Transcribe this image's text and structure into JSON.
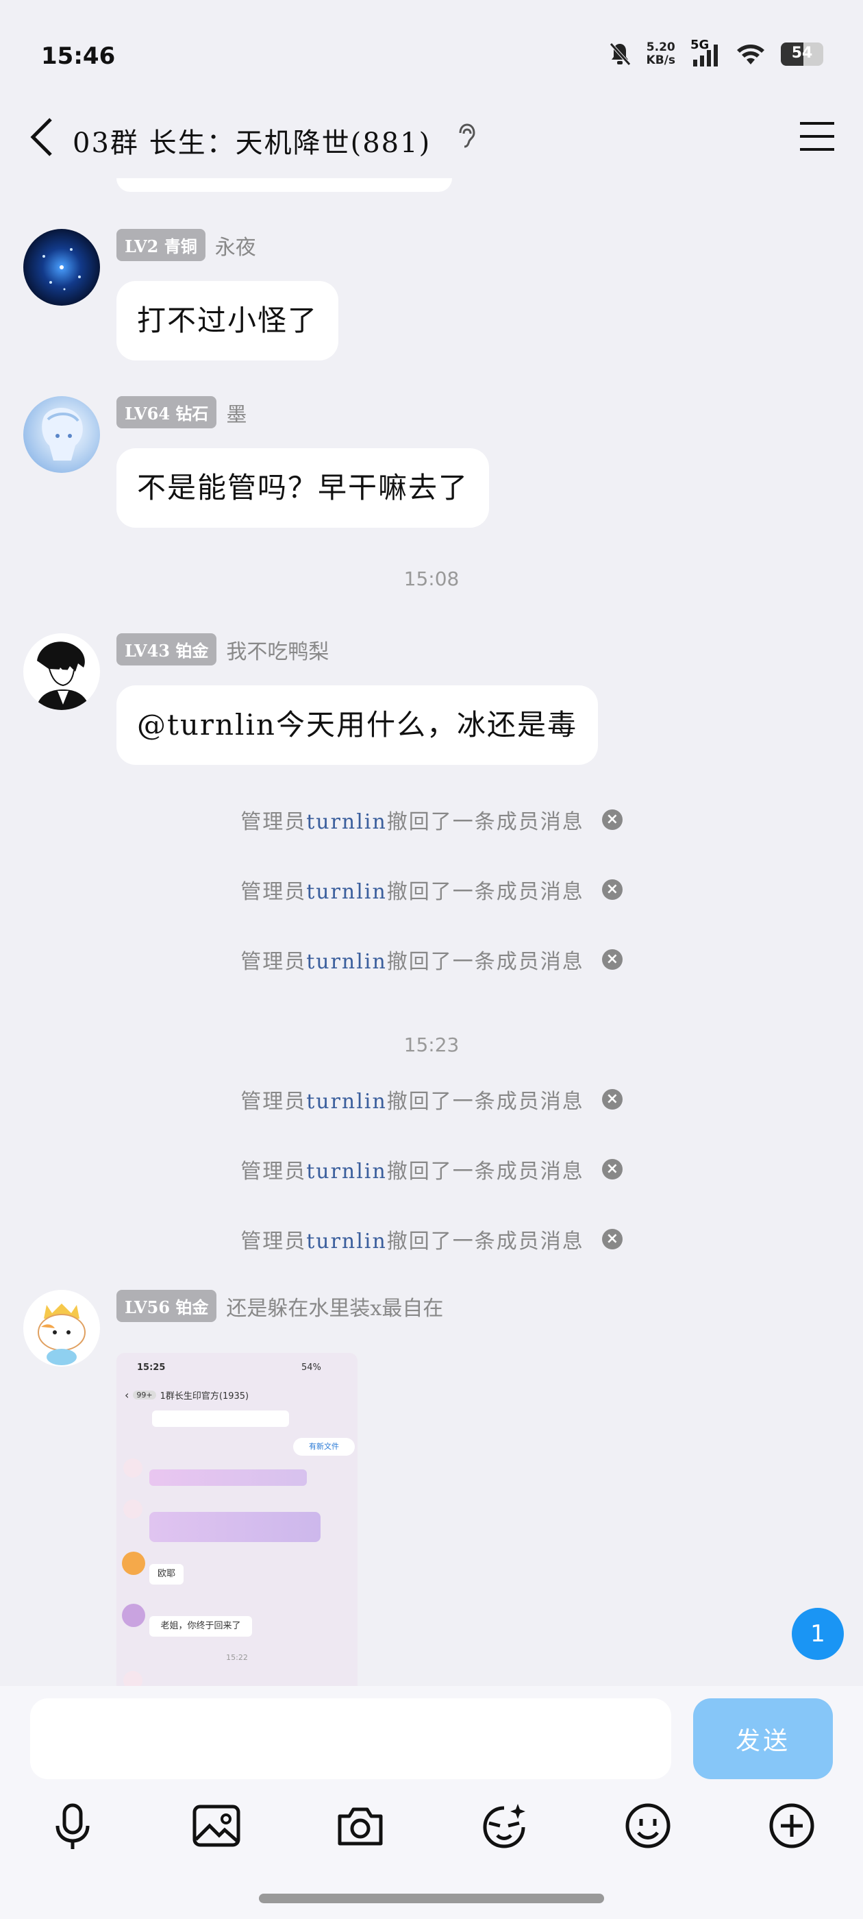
{
  "status_bar": {
    "time": "15:46",
    "net_speed": "5.20",
    "net_unit": "KB/s",
    "network": "5G",
    "battery": "54"
  },
  "header": {
    "title": "03群 长生：天机降世(881)"
  },
  "messages": [
    {
      "level": "LV2 青铜",
      "nick": "永夜",
      "text": "打不过小怪了"
    },
    {
      "level": "LV64 钻石",
      "nick": "墨",
      "text": "不是能管吗？早干嘛去了"
    },
    {
      "level": "LV43 铂金",
      "nick": "我不吃鸭梨",
      "text": "@turnlin今天用什么，冰还是毒"
    },
    {
      "level": "LV56 铂金",
      "nick": "还是躲在水里装x最自在"
    }
  ],
  "timestamps": [
    "15:08",
    "15:23"
  ],
  "system": {
    "prefix": "管理员",
    "admin": "turnlin",
    "suffix": "撤回了一条成员消息"
  },
  "screenshot_preview": {
    "time": "15:25",
    "battery": "54%",
    "badge": "99+",
    "title": "1群长生印官方(1935)",
    "new_file": "有新文件",
    "msg1": "欧耶",
    "msg2": "老姐，你终于回来了",
    "time2": "15:22"
  },
  "unread_count": "1",
  "input": {
    "placeholder": "",
    "send_label": "发送"
  },
  "icons": [
    "microphone-icon",
    "image-icon",
    "camera-icon",
    "emoji-face-icon",
    "smiley-icon",
    "plus-icon"
  ]
}
